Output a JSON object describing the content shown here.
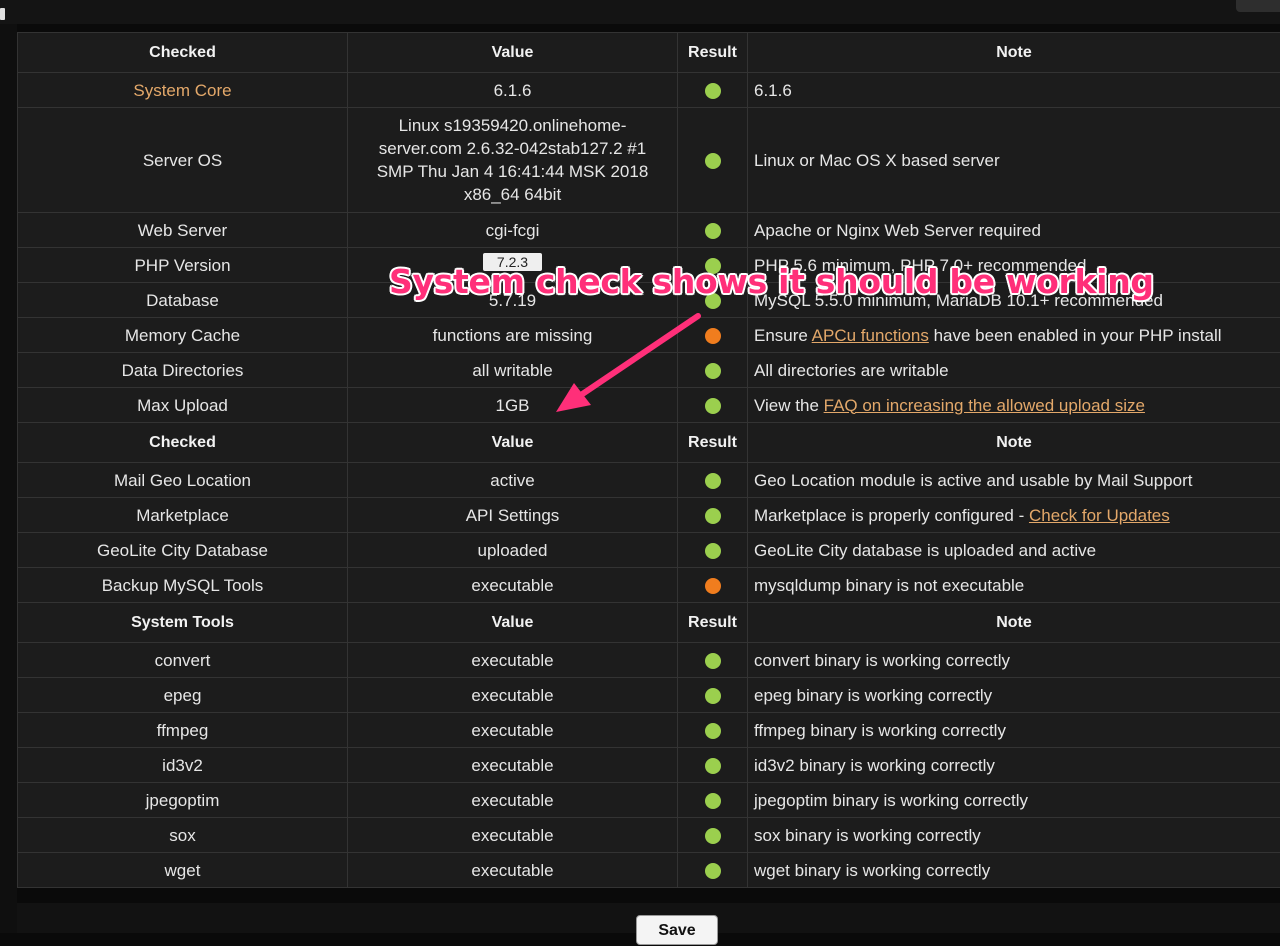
{
  "colors": {
    "ok": "#9bcf4e",
    "warning": "#f07d1e",
    "link": "#e3a86a",
    "annotation": "#ff2f79"
  },
  "annotation": {
    "text": "System check shows it should be working"
  },
  "footer": {
    "button_label": "Save"
  },
  "sections": [
    {
      "header": {
        "checked": "Checked",
        "value": "Value",
        "result": "Result",
        "note": "Note"
      },
      "rows": [
        {
          "checked": "System Core",
          "value": "6.1.6",
          "result": "ok",
          "note": "6.1.6"
        },
        {
          "checked": "Server OS",
          "value": "Linux s19359420.onlinehome-server.com 2.6.32-042stab127.2 #1 SMP Thu Jan 4 16:41:44 MSK 2018 x86_64 64bit",
          "result": "ok",
          "note": "Linux or Mac OS X based server"
        },
        {
          "checked": "Web Server",
          "value": "cgi-fcgi",
          "result": "ok",
          "note": "Apache or Nginx Web Server required"
        },
        {
          "checked": "PHP Version",
          "value": "7.2.3",
          "result": "ok",
          "note": "PHP 5.6 minimum, PHP 7.0+ recommended"
        },
        {
          "checked": "Database",
          "value": "5.7.19",
          "result": "ok",
          "note": "MySQL 5.5.0 minimum, MariaDB 10.1+ recommended"
        },
        {
          "checked": "Memory Cache",
          "value": "functions are missing",
          "result": "warning",
          "note_before": "Ensure ",
          "note_link": "APCu functions",
          "note_after": " have been enabled in your PHP install"
        },
        {
          "checked": "Data Directories",
          "value": "all writable",
          "result": "ok",
          "note": "All directories are writable"
        },
        {
          "checked": "Max Upload",
          "value": "1GB",
          "result": "ok",
          "note_before": "View the ",
          "note_link": "FAQ on increasing the allowed upload size"
        }
      ]
    },
    {
      "header": {
        "checked": "Checked",
        "value": "Value",
        "result": "Result",
        "note": "Note"
      },
      "rows": [
        {
          "checked": "Mail Geo Location",
          "value": "active",
          "result": "ok",
          "note": "Geo Location module is active and usable by Mail Support"
        },
        {
          "checked": "Marketplace",
          "value": "API Settings",
          "result": "ok",
          "note_before": "Marketplace is properly configured - ",
          "note_link": "Check for Updates"
        },
        {
          "checked": "GeoLite City Database",
          "value": "uploaded",
          "result": "ok",
          "note": "GeoLite City database is uploaded and active"
        },
        {
          "checked": "Backup MySQL Tools",
          "value": "executable",
          "result": "warning",
          "note": "mysqldump binary is not executable"
        }
      ]
    },
    {
      "header": {
        "checked": "System Tools",
        "value": "Value",
        "result": "Result",
        "note": "Note"
      },
      "rows": [
        {
          "checked": "convert",
          "value": "executable",
          "result": "ok",
          "note": "convert binary is working correctly"
        },
        {
          "checked": "epeg",
          "value": "executable",
          "result": "ok",
          "note": "epeg binary is working correctly"
        },
        {
          "checked": "ffmpeg",
          "value": "executable",
          "result": "ok",
          "note": "ffmpeg binary is working correctly"
        },
        {
          "checked": "id3v2",
          "value": "executable",
          "result": "ok",
          "note": "id3v2 binary is working correctly"
        },
        {
          "checked": "jpegoptim",
          "value": "executable",
          "result": "ok",
          "note": "jpegoptim binary is working correctly"
        },
        {
          "checked": "sox",
          "value": "executable",
          "result": "ok",
          "note": "sox binary is working correctly"
        },
        {
          "checked": "wget",
          "value": "executable",
          "result": "ok",
          "note": "wget binary is working correctly"
        }
      ]
    }
  ]
}
